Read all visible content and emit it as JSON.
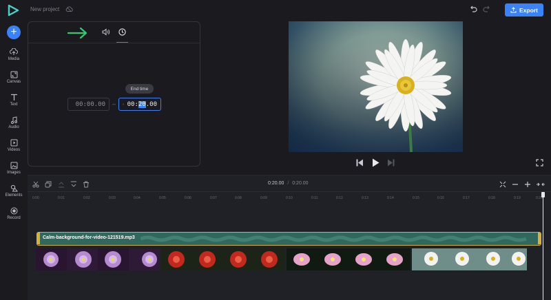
{
  "header": {
    "project_title": "New project",
    "export_label": "Export"
  },
  "sidebar": {
    "items": [
      {
        "label": "Media",
        "icon": "cloud-upload-icon"
      },
      {
        "label": "Canvas",
        "icon": "canvas-icon"
      },
      {
        "label": "Text",
        "icon": "text-icon"
      },
      {
        "label": "Audio",
        "icon": "music-note-icon"
      },
      {
        "label": "Videos",
        "icon": "video-icon"
      },
      {
        "label": "Images",
        "icon": "image-icon"
      },
      {
        "label": "Elements",
        "icon": "shapes-icon"
      },
      {
        "label": "Record",
        "icon": "record-icon"
      }
    ]
  },
  "panel": {
    "start_time": "00:00.00",
    "separator": "–",
    "end_time_prefix": "00:",
    "end_time_selected": "20",
    "end_time_suffix": ".00",
    "tooltip": "End time"
  },
  "timeline": {
    "current_time": "0:20.00",
    "time_separator": "/",
    "total_time": "0:20.00",
    "ruler": [
      "0:00",
      "0:01",
      "0:02",
      "0:03",
      "0:04",
      "0:05",
      "0:06",
      "0:07",
      "0:08",
      "0:09",
      "0:10",
      "0:11",
      "0:12",
      "0:13",
      "0:14",
      "0:15",
      "0:16",
      "0:17",
      "0:18",
      "0:19",
      "0:20"
    ],
    "audio_track_label": "Calm-background-for-video-121519.mp3"
  },
  "colors": {
    "accent": "#3b82f6",
    "audio_track": "#31685e",
    "selection_border": "#d6b23a",
    "arrow": "#2ecc71"
  }
}
